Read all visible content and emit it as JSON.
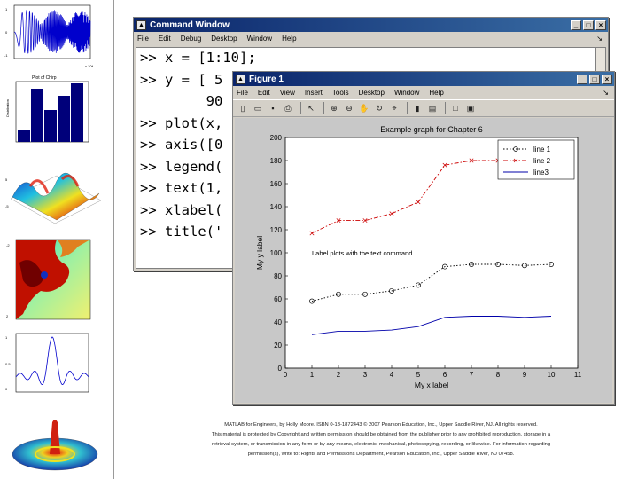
{
  "command_window": {
    "title": "Command Window",
    "menu": [
      "File",
      "Edit",
      "Debug",
      "Desktop",
      "Window",
      "Help"
    ],
    "menu_right": "↘",
    "lines": [
      ">> x = [1:10];",
      ">> y = [ 5",
      "        90",
      ">> plot(x,",
      ">> axis([0",
      ">> legend(",
      ">> text(1,",
      ">> xlabel(",
      ">> title('"
    ]
  },
  "figure_window": {
    "title": "Figure 1",
    "menu": [
      "File",
      "Edit",
      "View",
      "Insert",
      "Tools",
      "Desktop",
      "Window",
      "Help"
    ],
    "menu_right": "↘",
    "toolbar_icons": [
      "new-file-icon",
      "open-file-icon",
      "save-icon",
      "print-icon",
      "arrow-icon",
      "zoom-in-icon",
      "zoom-out-icon",
      "pan-icon",
      "rotate-icon",
      "data-cursor-icon",
      "colorbar-icon",
      "legend-icon",
      "hide-plot-tools-icon",
      "show-plot-tools-icon"
    ]
  },
  "chart_data": {
    "type": "line",
    "title": "Example graph for Chapter 6",
    "xlabel": "My x label",
    "ylabel": "My y label",
    "xlim": [
      0,
      11
    ],
    "ylim": [
      0,
      200
    ],
    "xticks": [
      0,
      1,
      2,
      3,
      4,
      5,
      6,
      7,
      8,
      9,
      10,
      11
    ],
    "yticks": [
      0,
      20,
      40,
      60,
      80,
      100,
      120,
      140,
      160,
      180,
      200
    ],
    "grid": false,
    "legend_position": "top-right",
    "x": [
      1,
      2,
      3,
      4,
      5,
      6,
      7,
      8,
      9,
      10
    ],
    "series": [
      {
        "name": "line 1",
        "values": [
          58,
          64,
          64,
          67,
          72,
          88,
          90,
          90,
          89,
          90
        ],
        "color": "#000000",
        "style": "dotted",
        "marker": "circle"
      },
      {
        "name": "line 2",
        "values": [
          117,
          128,
          128,
          134,
          144,
          176,
          180,
          180,
          178,
          180
        ],
        "color": "#cc0000",
        "style": "dashdot",
        "marker": "x"
      },
      {
        "name": "line3",
        "values": [
          29,
          32,
          32,
          33,
          36,
          44,
          45,
          45,
          44,
          45
        ],
        "color": "#0000aa",
        "style": "solid",
        "marker": "none"
      }
    ],
    "annotation": {
      "text": "Label plots with the text command",
      "x": 1,
      "y": 100
    }
  },
  "thumbnails": {
    "plot_caption": "Plot of Chirp",
    "bar_title": "Plot of Chirp"
  },
  "footer": {
    "line1": "MATLAB for Engineers, by Holly Moore. ISBN 0-13-1872443 © 2007 Pearson Education, Inc., Upper Saddle River, NJ. All rights reserved.",
    "line2": "This material is protected by Copyright and written permission should be obtained from the publisher prior to any prohibited reproduction, storage in a",
    "line3": "retrieval system, or transmission in any form or by any means, electronic, mechanical, photocopying, recording, or likewise. For information regarding",
    "line4": "permission(s), write to: Rights and Permissions Department, Pearson Education, Inc., Upper Saddle River, NJ 07458."
  }
}
